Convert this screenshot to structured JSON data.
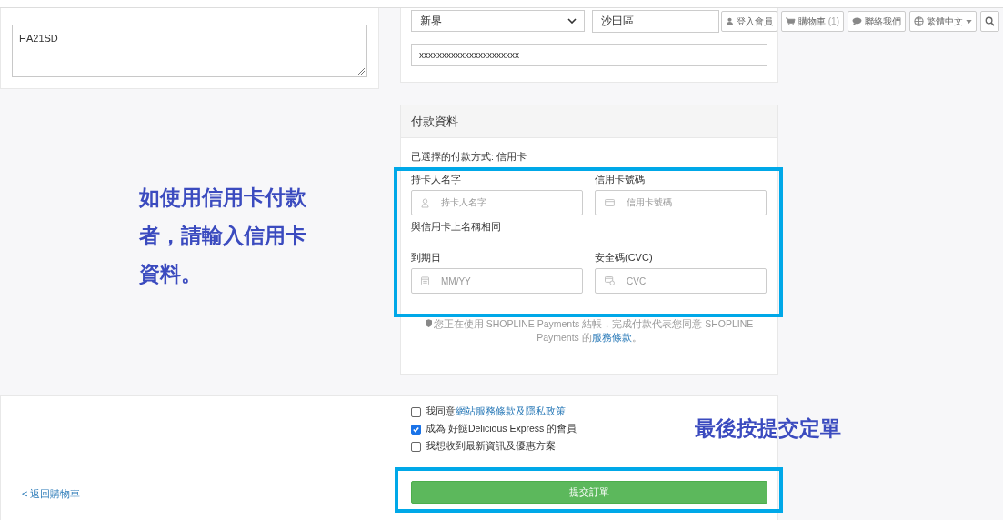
{
  "nav": [
    {
      "kind": "user",
      "label": "登入會員"
    },
    {
      "kind": "cart",
      "label": "購物車",
      "count": "(1)"
    },
    {
      "kind": "chat",
      "label": "聯絡我們"
    },
    {
      "kind": "language",
      "label": "繁體中文"
    },
    {
      "kind": "search"
    }
  ],
  "remarks": {
    "value": "HA21SD"
  },
  "address": {
    "region": "新界",
    "district": "沙田區",
    "line": "xxxxxxxxxxxxxxxxxxxxxx"
  },
  "payment": {
    "title": "付款資料",
    "method": "已選擇的付款方式: 信用卡",
    "fields": [
      {
        "kind": "person",
        "label": "持卡人名字",
        "placeholder": "持卡人名字",
        "hint": "與信用卡上名稱相同"
      },
      {
        "kind": "card",
        "label": "信用卡號碼",
        "placeholder": "信用卡號碼"
      },
      {
        "kind": "calendar",
        "label": "到期日",
        "placeholder": "MM/YY"
      },
      {
        "kind": "cvc",
        "label": "安全碼(CVC)",
        "placeholder": "CVC"
      }
    ],
    "notice": {
      "text": "您正在使用 SHOPLINE Payments 結帳，完成付款代表您同意 SHOPLINE Payments 的",
      "link": "服務條款",
      "end": "。"
    }
  },
  "agreements": [
    {
      "text": "我同意",
      "link": "網站服務條款及隱私政策",
      "checked": false
    },
    {
      "text": "成為 好餸Delicious Express 的會員",
      "checked": true
    },
    {
      "text": "我想收到最新資訊及優惠方案",
      "checked": false
    }
  ],
  "back_link": "< 返回購物車",
  "submit": "提交訂單",
  "annotations": [
    {
      "kind": "left",
      "text": "如使用信用卡付款者，請輸入信用卡資料。"
    },
    {
      "kind": "right",
      "text": "最後按提交定單"
    }
  ]
}
